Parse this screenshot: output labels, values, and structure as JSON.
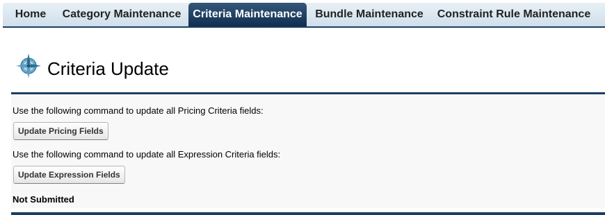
{
  "tabs": [
    {
      "label": "Home",
      "active": false
    },
    {
      "label": "Category Maintenance",
      "active": false
    },
    {
      "label": "Criteria Maintenance",
      "active": true
    },
    {
      "label": "Bundle Maintenance",
      "active": false
    },
    {
      "label": "Constraint Rule Maintenance",
      "active": false
    }
  ],
  "header": {
    "icon": "compass-icon",
    "title": "Criteria Update"
  },
  "pricing": {
    "description": "Use the following command to update all Pricing Criteria fields:",
    "button_label": "Update Pricing Fields"
  },
  "expression": {
    "description": "Use the following command to update all Expression Criteria fields:",
    "button_label": "Update Expression Fields"
  },
  "status": "Not Submitted",
  "colors": {
    "nav_dark": "#1c3e60",
    "tab_bar_light": "#e8f0f6",
    "panel_bg": "#f8f8f8"
  }
}
